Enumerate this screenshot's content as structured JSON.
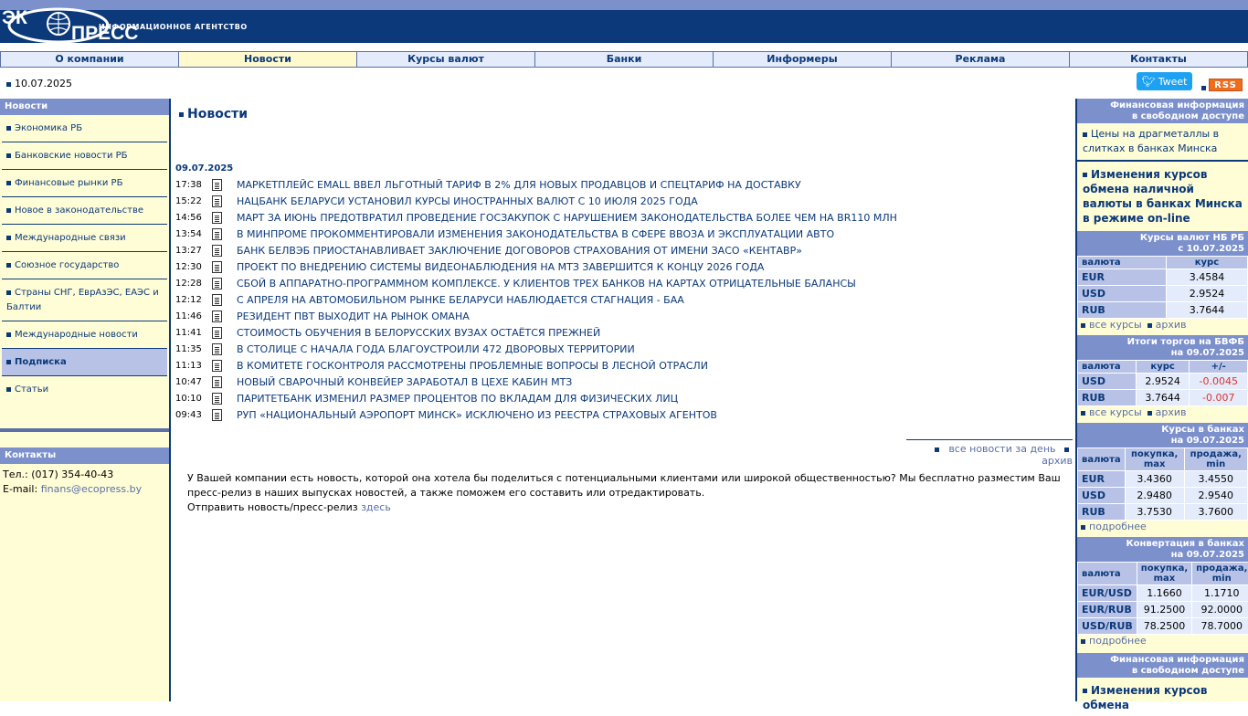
{
  "header": {
    "logo_text": "ЭКОПРЕСС",
    "agency_label": "ИНФОРМАЦИОННОЕ АГЕНТСТВО"
  },
  "menu": [
    "О компании",
    "Новости",
    "Курсы валют",
    "Банки",
    "Информеры",
    "Реклама",
    "Контакты"
  ],
  "date": "10.07.2025",
  "tweet_label": "Tweet",
  "rss_label": "RSS",
  "left": {
    "news_heading": "Новости",
    "items": [
      "Экономика РБ",
      "Банковские новости РБ",
      "Финансовые рынки РБ",
      "Новое в законодательстве",
      "Международные связи",
      "Союзное государство",
      "Страны СНГ, ЕврАзЭС, ЕАЭС и Балтии",
      "Международные новости",
      "Подписка",
      "Статьи"
    ],
    "contacts_heading": "Контакты",
    "phone": "Тел.: (017) 354-40-43",
    "email_label": "E-mail:",
    "email": "finans@ecopress.by"
  },
  "main": {
    "title": "Новости",
    "news_date": "09.07.2025",
    "news": [
      {
        "time": "17:38",
        "title": "МАРКЕТПЛЕЙС EMALL ВВЕЛ ЛЬГОТНЫЙ ТАРИФ В 2% ДЛЯ НОВЫХ ПРОДАВЦОВ И СПЕЦТАРИФ НА ДОСТАВКУ"
      },
      {
        "time": "15:22",
        "title": "НАЦБАНК БЕЛАРУСИ УСТАНОВИЛ КУРСЫ ИНОСТРАННЫХ ВАЛЮТ С 10 ИЮЛЯ 2025 ГОДА"
      },
      {
        "time": "14:56",
        "title": "МАРТ ЗА ИЮНЬ ПРЕДОТВРАТИЛ ПРОВЕДЕНИЕ ГОСЗАКУПОК С НАРУШЕНИЕМ ЗАКОНОДАТЕЛЬСТВА БОЛЕЕ ЧЕМ НА BR110 МЛН"
      },
      {
        "time": "13:54",
        "title": "В МИНПРОМЕ ПРОКОММЕНТИРОВАЛИ ИЗМЕНЕНИЯ ЗАКОНОДАТЕЛЬСТВА В СФЕРЕ ВВОЗА И ЭКСПЛУАТАЦИИ АВТО"
      },
      {
        "time": "13:27",
        "title": "БАНК БЕЛВЭБ ПРИОСТАНАВЛИВАЕТ ЗАКЛЮЧЕНИЕ ДОГОВОРОВ СТРАХОВАНИЯ ОТ ИМЕНИ ЗАСО «КЕНТАВР»"
      },
      {
        "time": "12:30",
        "title": "ПРОЕКТ ПО ВНЕДРЕНИЮ СИСТЕМЫ ВИДЕОНАБЛЮДЕНИЯ НА МТЗ ЗАВЕРШИТСЯ К КОНЦУ 2026 ГОДА"
      },
      {
        "time": "12:28",
        "title": "СБОЙ В АППАРАТНО-ПРОГРАММНОМ КОМПЛЕКСЕ. У КЛИЕНТОВ ТРЕХ БАНКОВ НА КАРТАХ ОТРИЦАТЕЛЬНЫЕ БАЛАНСЫ"
      },
      {
        "time": "12:12",
        "title": "С АПРЕЛЯ НА АВТОМОБИЛЬНОМ РЫНКЕ БЕЛАРУСИ НАБЛЮДАЕТСЯ СТАГНАЦИЯ - БАА"
      },
      {
        "time": "11:46",
        "title": "РЕЗИДЕНТ ПВТ ВЫХОДИТ НА РЫНОК ОМАНА"
      },
      {
        "time": "11:41",
        "title": "СТОИМОСТЬ ОБУЧЕНИЯ В БЕЛОРУССКИХ ВУЗАХ ОСТАЁТСЯ ПРЕЖНЕЙ"
      },
      {
        "time": "11:35",
        "title": "В СТОЛИЦЕ С НАЧАЛА ГОДА БЛАГОУСТРОИЛИ 472 ДВОРОВЫХ ТЕРРИТОРИИ"
      },
      {
        "time": "11:13",
        "title": "В КОМИТЕТЕ ГОСКОНТРОЛЯ РАССМОТРЕНЫ ПРОБЛЕМНЫЕ ВОПРОСЫ В ЛЕСНОЙ ОТРАСЛИ"
      },
      {
        "time": "10:47",
        "title": "НОВЫЙ СВАРОЧНЫЙ КОНВЕЙЕР ЗАРАБОТАЛ В ЦЕХЕ КАБИН МТЗ"
      },
      {
        "time": "10:10",
        "title": "ПАРИТЕТБАНК ИЗМЕНИЛ РАЗМЕР ПРОЦЕНТОВ ПО ВКЛАДАМ ДЛЯ ФИЗИЧЕСКИХ ЛИЦ"
      },
      {
        "time": "09:43",
        "title": "РУП «НАЦИОНАЛЬНЫЙ АЭРОПОРТ МИНСК» ИСКЛЮЧЕНО ИЗ РЕЕСТРА СТРАХОВЫХ АГЕНТОВ"
      }
    ],
    "all_news_label": "все новости за день",
    "archive_label": "архив",
    "promo_text": "У Вашей компании есть новость, которой она хотела бы поделиться с потенциальными клиентами или широкой общественностью? Мы бесплатно разместим Ваш пресс-релиз в наших выпусках новостей, а также поможем его составить или отредактировать.",
    "promo_send": "Отправить новость/пресс-релиз",
    "promo_link": "здесь"
  },
  "right": {
    "fin_heading_1": "Финансовая информация",
    "fin_heading_2": "в свободном доступе",
    "metals_link": "Цены на драгметаллы в слитках в банках Минска",
    "exchange_link": "Изменения курсов обмена наличной валюты в банках Минска в режиме on-line",
    "nb_heading_1": "Курсы валют НБ РБ",
    "nb_heading_2": "с 10.07.2025",
    "nb_cols": [
      "валюта",
      "курс"
    ],
    "nb_rows": [
      [
        "EUR",
        "3.4584"
      ],
      [
        "USD",
        "2.9524"
      ],
      [
        "RUB",
        "3.7644"
      ]
    ],
    "all_rates_label": "все курсы",
    "archive_label": "архив",
    "bvfb_heading_1": "Итоги торгов на БВФБ",
    "bvfb_heading_2": "на 09.07.2025",
    "bvfb_cols": [
      "валюта",
      "курс",
      "+/-"
    ],
    "bvfb_rows": [
      [
        "USD",
        "2.9524",
        "-0.0045"
      ],
      [
        "RUB",
        "3.7644",
        "-0.007"
      ]
    ],
    "banks_heading_1": "Курсы в банках",
    "banks_heading_2": "на 09.07.2025",
    "banks_cols": [
      "валюта",
      "покупка, max",
      "продажа, min"
    ],
    "banks_rows": [
      [
        "EUR",
        "3.4360",
        "3.4550"
      ],
      [
        "USD",
        "2.9480",
        "2.9540"
      ],
      [
        "RUB",
        "3.7530",
        "3.7600"
      ]
    ],
    "more_label": "подробнее",
    "conv_heading_1": "Конвертация в банках",
    "conv_heading_2": "на 09.07.2025",
    "conv_cols": [
      "валюта",
      "покупка, max",
      "продажа, min"
    ],
    "conv_rows": [
      [
        "EUR/USD",
        "1.1660",
        "1.1710"
      ],
      [
        "EUR/RUB",
        "91.2500",
        "92.0000"
      ],
      [
        "USD/RUB",
        "78.2500",
        "78.7000"
      ]
    ],
    "fin2_heading_1": "Финансовая информация",
    "fin2_heading_2": "в свободном доступе",
    "exchange_link_2": "Изменения курсов обмена"
  },
  "colors": {
    "header_navy": "#0b3979",
    "header_light": "#7c90cc",
    "sidebar_bg": "#fffdd6",
    "active_menu": "#fffacd",
    "tweet_blue": "#1da1f2",
    "rss_orange": "#ee6e1e",
    "negative_red": "#dd3333"
  },
  "icons": {
    "logo": "ecopress-globe-logo",
    "news_doc": "document-icon",
    "tweet": "twitter-bird-icon"
  }
}
